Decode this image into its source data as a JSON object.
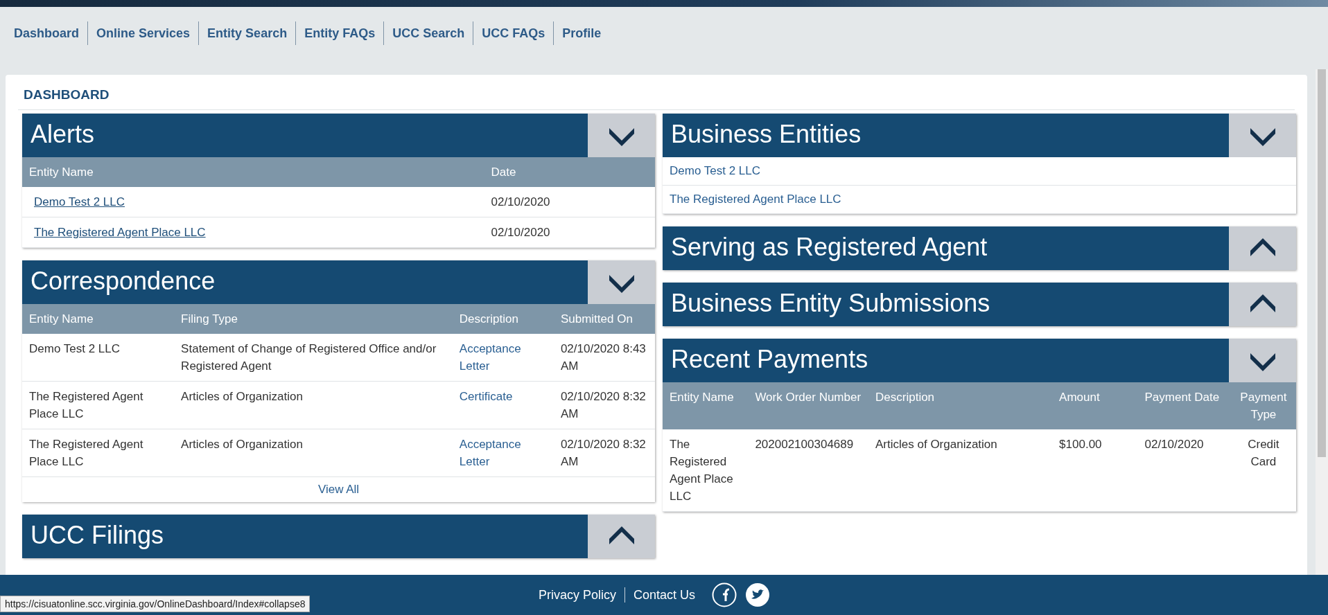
{
  "nav": [
    {
      "label": "Dashboard"
    },
    {
      "label": "Online Services"
    },
    {
      "label": "Entity Search"
    },
    {
      "label": "Entity FAQs"
    },
    {
      "label": "UCC Search"
    },
    {
      "label": "UCC FAQs"
    },
    {
      "label": "Profile"
    }
  ],
  "page_title": "DASHBOARD",
  "left_panels": [
    {
      "title": "Alerts",
      "expanded": true,
      "kind": "table",
      "columns": [
        {
          "label": "Entity Name",
          "kind": "link"
        },
        {
          "label": "Date",
          "kind": "text"
        }
      ],
      "rows": [
        [
          "Demo Test 2 LLC",
          "02/10/2020"
        ],
        [
          "The Registered Agent Place LLC",
          "02/10/2020"
        ]
      ]
    },
    {
      "title": "Correspondence",
      "expanded": true,
      "kind": "table",
      "columns": [
        {
          "label": "Entity Name",
          "kind": "text"
        },
        {
          "label": "Filing Type",
          "kind": "text"
        },
        {
          "label": "Description",
          "kind": "action"
        },
        {
          "label": "Submitted On",
          "kind": "text"
        }
      ],
      "rows": [
        [
          "Demo Test 2 LLC",
          "Statement of Change of Registered Office and/or Registered Agent",
          "Acceptance Letter",
          "02/10/2020 8:43 AM"
        ],
        [
          "The Registered Agent Place LLC",
          "Articles of Organization",
          "Certificate",
          "02/10/2020 8:32 AM"
        ],
        [
          "The Registered Agent Place LLC",
          "Articles of Organization",
          "Acceptance Letter",
          "02/10/2020 8:32 AM"
        ]
      ],
      "footer_link": "View All"
    },
    {
      "title": "UCC Filings",
      "expanded": false
    }
  ],
  "right_panels": [
    {
      "title": "Business Entities",
      "expanded": true,
      "kind": "list",
      "items": [
        "Demo Test 2 LLC",
        "The Registered Agent Place LLC"
      ]
    },
    {
      "title": "Serving as Registered Agent",
      "expanded": false
    },
    {
      "title": "Business Entity Submissions",
      "expanded": false
    },
    {
      "title": "Recent Payments",
      "expanded": true,
      "kind": "table",
      "columns": [
        {
          "label": "Entity Name",
          "kind": "text"
        },
        {
          "label": "Work Order Number",
          "kind": "text"
        },
        {
          "label": "Description",
          "kind": "text"
        },
        {
          "label": "Amount",
          "kind": "text"
        },
        {
          "label": "Payment Date",
          "kind": "text"
        },
        {
          "label": "Payment Type",
          "kind": "center"
        }
      ],
      "rows": [
        [
          "The Registered Agent Place LLC",
          "202002100304689",
          "Articles of Organization",
          "$100.00",
          "02/10/2020",
          "Credit Card"
        ]
      ]
    }
  ],
  "footer": {
    "links": [
      "Privacy Policy",
      "Contact Us"
    ]
  },
  "status_url": "https://cisuatonline.scc.virginia.gov/OnlineDashboard/Index#collapse8"
}
